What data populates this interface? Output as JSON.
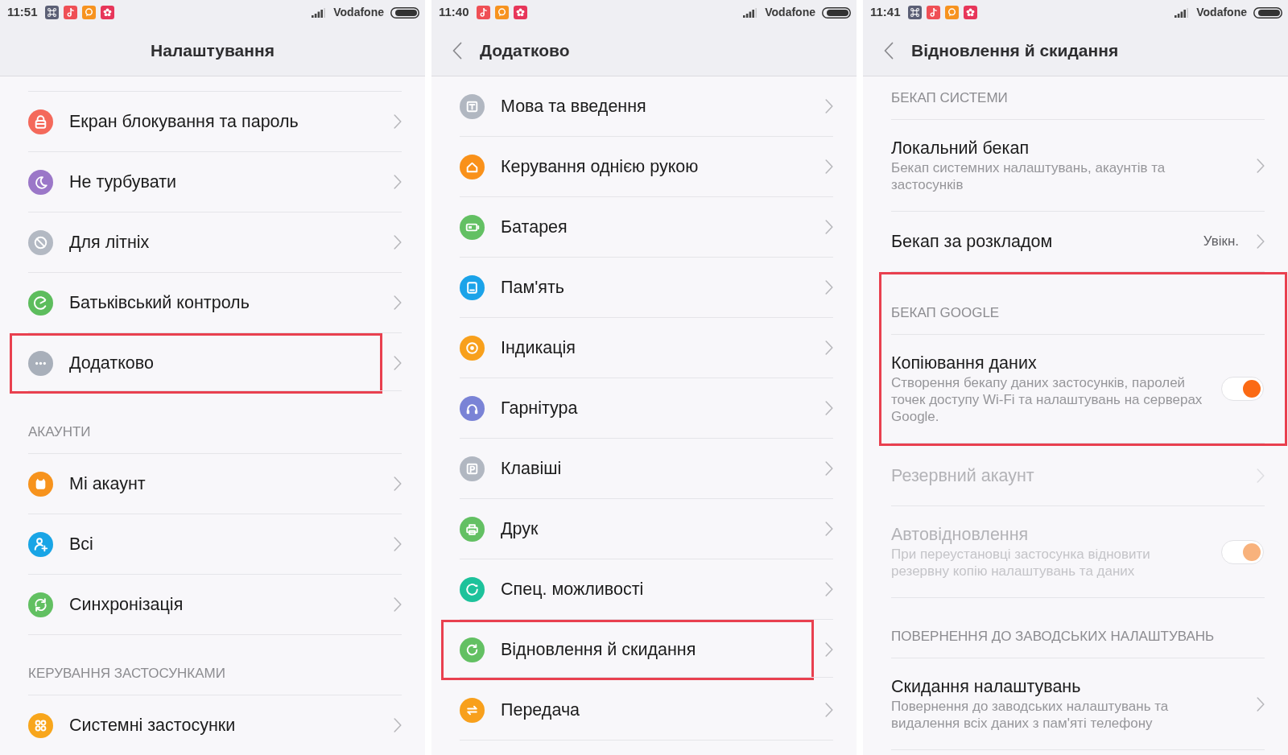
{
  "screens": [
    {
      "status_bar": {
        "time": "11:51",
        "notifications": [
          {
            "kind": "app"
          },
          {
            "kind": "music"
          },
          {
            "kind": "chat"
          },
          {
            "kind": "flower"
          }
        ],
        "carrier": "Vodafone"
      },
      "header": {
        "title": "Налаштування",
        "back_button": false
      },
      "sections": [
        {
          "items": [
            {
              "title": "Екран блокування та пароль",
              "highlighted": false
            },
            {
              "title": "Не турбувати",
              "highlighted": false
            },
            {
              "title": "Для літніх",
              "highlighted": false
            },
            {
              "title": "Батьківський контроль",
              "highlighted": false
            },
            {
              "title": "Додатково",
              "highlighted": true
            }
          ]
        },
        {
          "title": "АКАУНТИ",
          "items": [
            {
              "title": "Мі акаунт",
              "highlighted": false
            },
            {
              "title": "Всі",
              "highlighted": false
            },
            {
              "title": "Синхронізація",
              "highlighted": false
            }
          ]
        },
        {
          "title": "КЕРУВАННЯ ЗАСТОСУНКАМИ",
          "items": [
            {
              "title": "Системні застосунки",
              "highlighted": false
            }
          ]
        }
      ]
    },
    {
      "status_bar": {
        "time": "11:40",
        "notifications": [
          {
            "kind": "music"
          },
          {
            "kind": "chat"
          },
          {
            "kind": "flower"
          }
        ],
        "carrier": "Vodafone"
      },
      "header": {
        "title": "Додатково",
        "back_button": true
      },
      "sections": [
        {
          "items": [
            {
              "title": "Мова та введення",
              "highlighted": false
            },
            {
              "title": "Керування однією рукою",
              "highlighted": false
            },
            {
              "title": "Батарея",
              "highlighted": false
            },
            {
              "title": "Пам'ять",
              "highlighted": false
            },
            {
              "title": "Індикація",
              "highlighted": false
            },
            {
              "title": "Гарнітура",
              "highlighted": false
            },
            {
              "title": "Клавіші",
              "highlighted": false
            },
            {
              "title": "Друк",
              "highlighted": false
            },
            {
              "title": "Спец. можливості",
              "highlighted": false
            },
            {
              "title": "Відновлення й скидання",
              "highlighted": true
            },
            {
              "title": "Передача",
              "highlighted": false
            }
          ]
        }
      ]
    },
    {
      "status_bar": {
        "time": "11:41",
        "notifications": [
          {
            "kind": "app"
          },
          {
            "kind": "music"
          },
          {
            "kind": "chat"
          },
          {
            "kind": "flower"
          }
        ],
        "carrier": "Vodafone"
      },
      "header": {
        "title": "Відновлення й скидання",
        "back_button": true
      },
      "sections": [
        {
          "title": "БЕКАП СИСТЕМИ",
          "highlighted": false,
          "items": [
            {
              "kind": "link",
              "title": "Локальний бекап",
              "description": "Бекап системних налаштувань, акаунтів та застосунків",
              "disabled": false
            },
            {
              "kind": "link",
              "title": "Бекап за розкладом",
              "value": "Увікн.",
              "disabled": false
            }
          ]
        },
        {
          "title": "БЕКАП GOOGLE",
          "highlighted": true,
          "items": [
            {
              "kind": "toggle",
              "title": "Копіювання даних",
              "description": "Створення бекапу даних застосунків, паролей точек доступу Wi-Fi та налаштувань на серверах Google.",
              "on": true,
              "disabled": false
            }
          ]
        },
        {
          "highlighted": false,
          "items": [
            {
              "kind": "link",
              "title": "Резервний акаунт",
              "disabled": true
            },
            {
              "kind": "toggle",
              "title": "Автовідновлення",
              "description": "При переустановці застосунка відновити резервну копію налаштувань та даних",
              "on": true,
              "disabled": true
            }
          ]
        },
        {
          "title": "ПОВЕРНЕННЯ ДО ЗАВОДСЬКИХ НАЛАШТУВАНЬ",
          "highlighted": false,
          "items": [
            {
              "kind": "link",
              "title": "Скидання налаштувань",
              "description": "Повернення до заводських налаштувань та видалення всіх даних з пам'яті телефону",
              "disabled": false
            }
          ]
        }
      ]
    }
  ]
}
